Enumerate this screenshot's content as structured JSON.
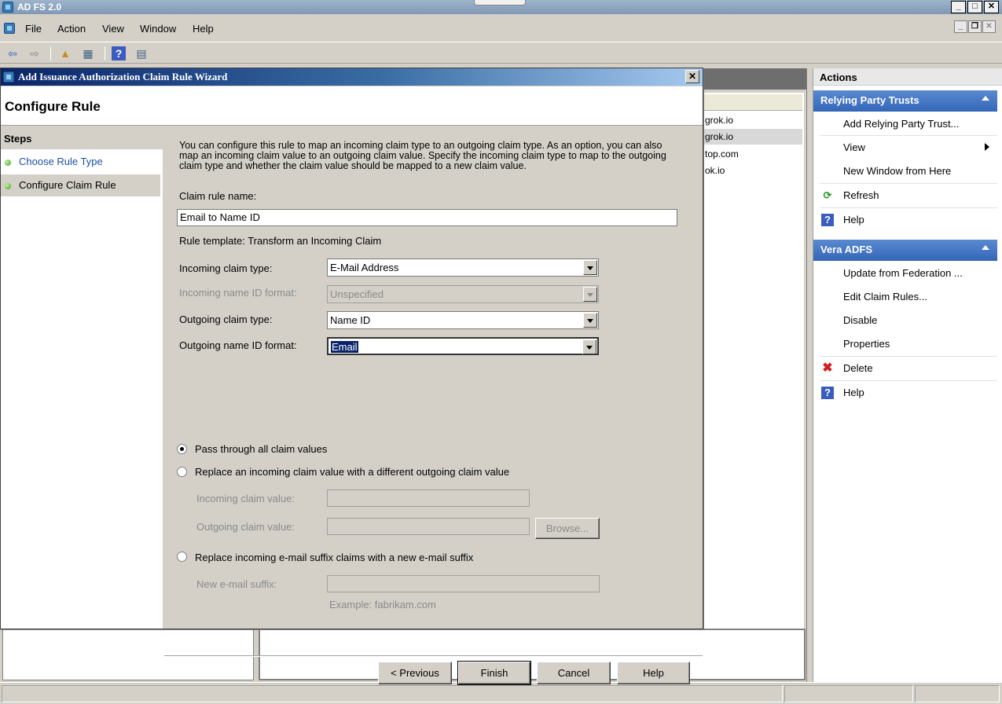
{
  "app": {
    "title": "AD FS 2.0",
    "menu": [
      "File",
      "Action",
      "View",
      "Window",
      "Help"
    ]
  },
  "list": {
    "rows": [
      "grok.io",
      "grok.io",
      "top.com",
      "ok.io"
    ]
  },
  "actions": {
    "header": "Actions",
    "sections": [
      {
        "title": "Relying Party Trusts",
        "items": [
          {
            "label": "Add Relying Party Trust...",
            "icon": ""
          },
          {
            "label": "View",
            "icon": "",
            "submenu": true
          },
          {
            "label": "New Window from Here",
            "icon": ""
          },
          {
            "label": "Refresh",
            "icon": "refresh-icon"
          },
          {
            "label": "Help",
            "icon": "help-icon"
          }
        ]
      },
      {
        "title": "Vera ADFS",
        "items": [
          {
            "label": "Update from Federation ...",
            "icon": ""
          },
          {
            "label": "Edit Claim Rules...",
            "icon": ""
          },
          {
            "label": "Disable",
            "icon": ""
          },
          {
            "label": "Properties",
            "icon": ""
          },
          {
            "label": "Delete",
            "icon": "delete-icon"
          },
          {
            "label": "Help",
            "icon": "help-icon"
          }
        ]
      }
    ]
  },
  "wizard": {
    "title": "Add Issuance Authorization Claim Rule Wizard",
    "heading": "Configure Rule",
    "steps_header": "Steps",
    "steps": [
      "Choose Rule Type",
      "Configure Claim Rule"
    ],
    "description": "You can configure this rule to map an incoming claim type to an outgoing claim type. As an option, you can also map an incoming claim value to an outgoing claim value. Specify the incoming claim type to map to the outgoing claim type and whether the claim value should be mapped to a new claim value.",
    "claim_rule_name_label": "Claim rule name:",
    "claim_rule_name_value": "Email to Name ID",
    "rule_template": "Rule template: Transform an Incoming Claim",
    "incoming_claim_type_label": "Incoming claim type:",
    "incoming_claim_type_value": "E-Mail Address",
    "incoming_name_id_format_label": "Incoming name ID format:",
    "incoming_name_id_format_value": "Unspecified",
    "outgoing_claim_type_label": "Outgoing claim type:",
    "outgoing_claim_type_value": "Name ID",
    "outgoing_name_id_format_label": "Outgoing name ID format:",
    "outgoing_name_id_format_value": "Email",
    "radio_pass_through": "Pass through all claim values",
    "radio_replace_value": "Replace an incoming claim value with a different outgoing claim value",
    "incoming_claim_value_label": "Incoming claim value:",
    "outgoing_claim_value_label": "Outgoing claim value:",
    "browse_label": "Browse...",
    "radio_replace_suffix": "Replace incoming e-mail suffix claims with a new e-mail suffix",
    "new_suffix_label": "New e-mail suffix:",
    "example_text": "Example: fabrikam.com",
    "buttons": {
      "previous": "< Previous",
      "finish": "Finish",
      "cancel": "Cancel",
      "help": "Help"
    }
  }
}
